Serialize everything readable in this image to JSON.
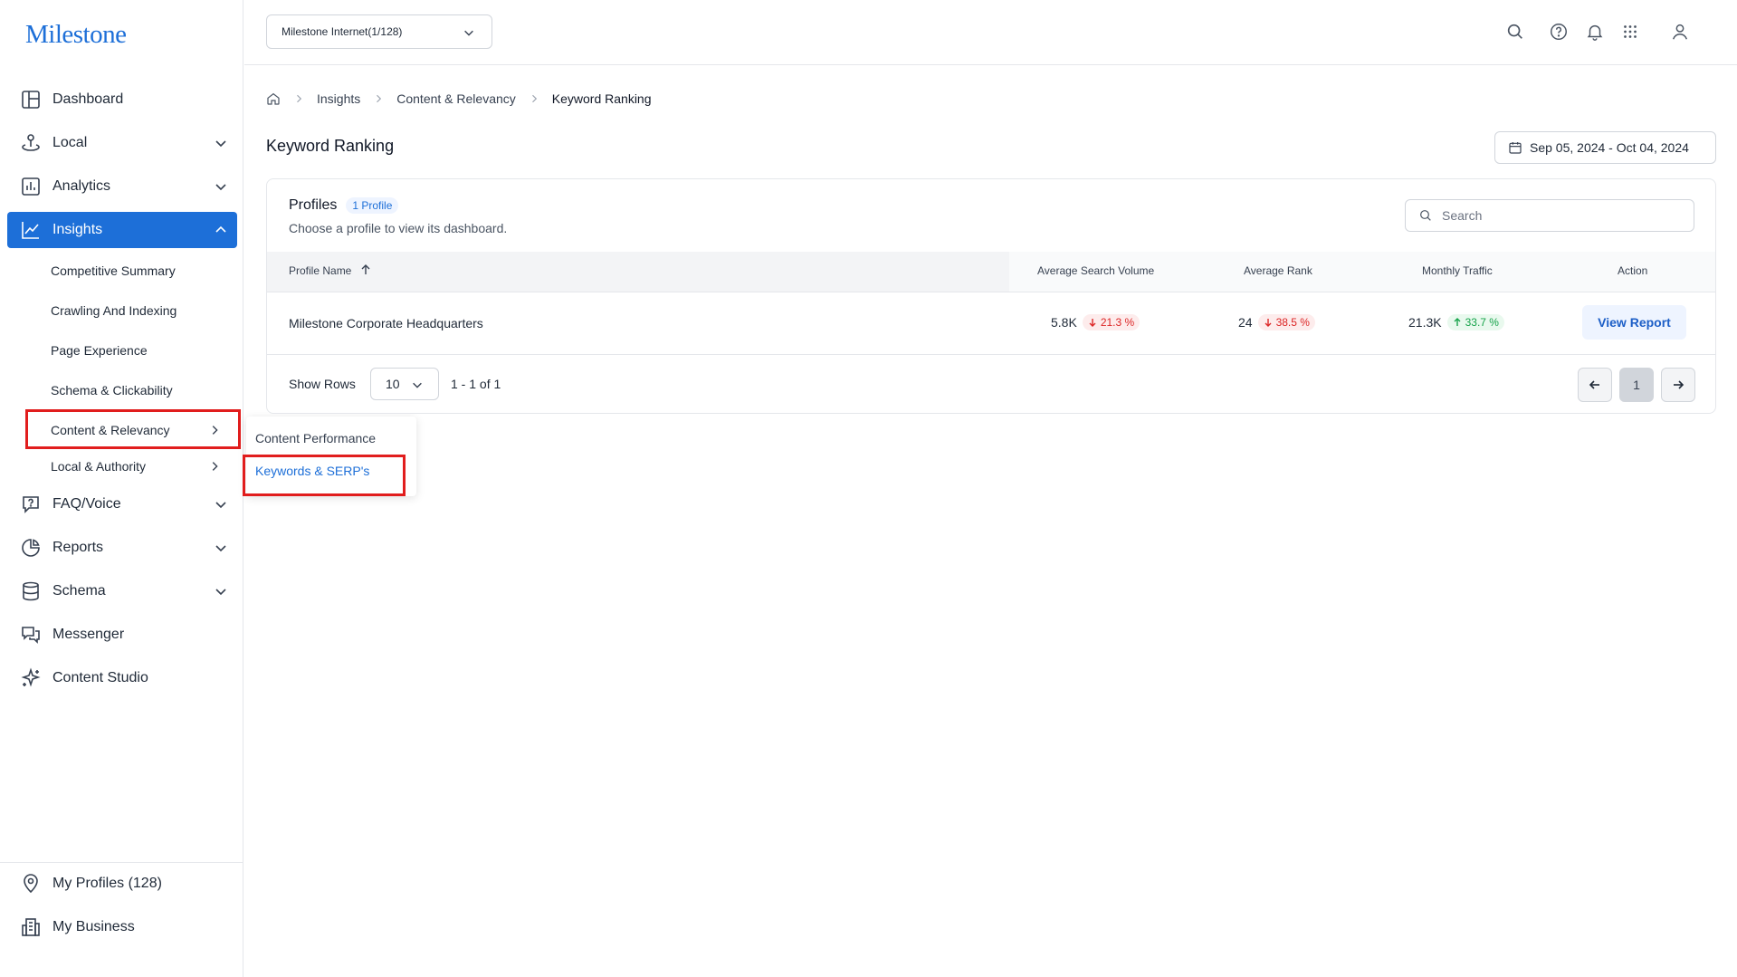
{
  "brand": {
    "logo_text": "Milestone",
    "accent": "#1d6fd8"
  },
  "sidebar": {
    "items": [
      {
        "label": "Dashboard",
        "icon": "dashboard-icon"
      },
      {
        "label": "Local",
        "icon": "local-icon"
      },
      {
        "label": "Analytics",
        "icon": "analytics-icon"
      },
      {
        "label": "Insights",
        "icon": "insights-icon",
        "active": true
      },
      {
        "label": "FAQ/Voice",
        "icon": "faq-icon"
      },
      {
        "label": "Reports",
        "icon": "reports-icon"
      },
      {
        "label": "Schema",
        "icon": "database-icon"
      },
      {
        "label": "Messenger",
        "icon": "messenger-icon"
      },
      {
        "label": "Content Studio",
        "icon": "sparkle-icon"
      }
    ],
    "insights_sub": [
      "Competitive Summary",
      "Crawling And Indexing",
      "Page Experience",
      "Schema & Clickability",
      "Content & Relevancy",
      "Local & Authority"
    ],
    "bottom": [
      {
        "label": "My Profiles (128)",
        "icon": "location-pin-icon"
      },
      {
        "label": "My Business",
        "icon": "business-icon"
      }
    ]
  },
  "flyout": {
    "items": [
      "Content Performance",
      "Keywords & SERP's"
    ],
    "selected": "Keywords & SERP's"
  },
  "topbar": {
    "account": "Milestone Internet(1/128)"
  },
  "breadcrumb": {
    "items": [
      "Insights",
      "Content & Relevancy",
      "Keyword Ranking"
    ]
  },
  "page": {
    "title": "Keyword Ranking",
    "date_range": "Sep 05, 2024 - Oct 04, 2024"
  },
  "card": {
    "title": "Profiles",
    "badge": "1 Profile",
    "subtitle": "Choose a profile to view its dashboard.",
    "search_placeholder": "Search"
  },
  "table": {
    "columns": [
      "Profile Name",
      "Average Search Volume",
      "Average Rank",
      "Monthly Traffic",
      "Action"
    ],
    "rows": [
      {
        "profile": "Milestone Corporate Headquarters",
        "search_volume": "5.8K",
        "search_volume_change": "21.3 %",
        "rank": "24",
        "rank_change": "38.5 %",
        "traffic": "21.3K",
        "traffic_change": "33.7 %",
        "action": "View Report"
      }
    ]
  },
  "pagination": {
    "show_rows_label": "Show Rows",
    "rows": "10",
    "range": "1 - 1 of 1",
    "current_page": "1"
  }
}
